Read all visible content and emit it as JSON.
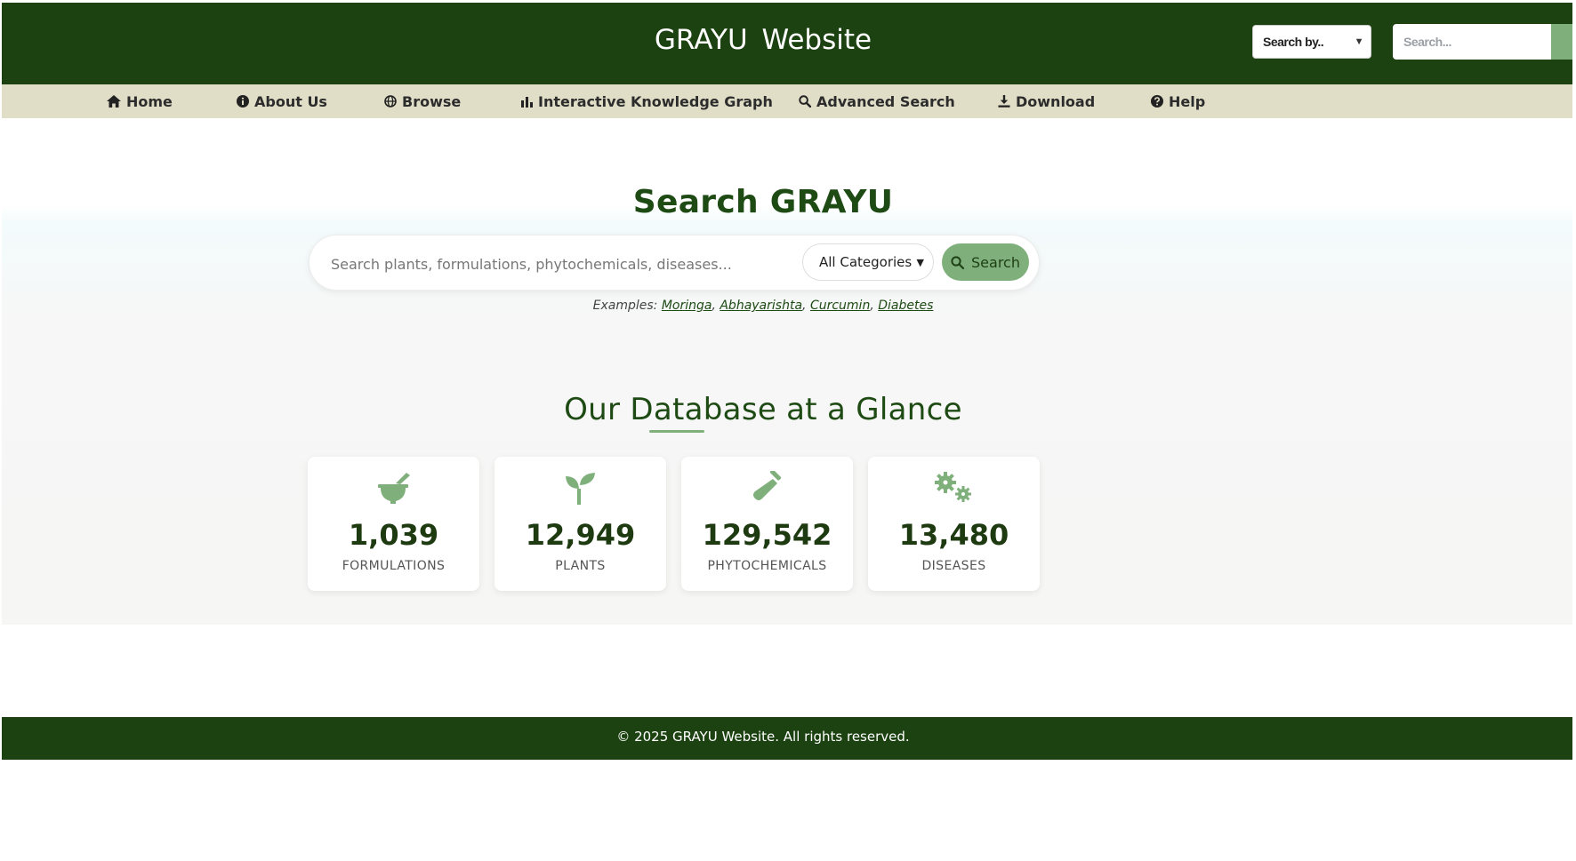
{
  "header": {
    "title": "GRAYU  Website",
    "search_by": "Search by..",
    "search_placeholder": "Search..."
  },
  "nav": {
    "items": [
      {
        "label": "Home",
        "icon": "home-icon"
      },
      {
        "label": "About Us",
        "icon": "info-icon"
      },
      {
        "label": "Browse",
        "icon": "globe-icon"
      },
      {
        "label": "Interactive Knowledge Graph",
        "icon": "chart-icon"
      },
      {
        "label": "Advanced Search",
        "icon": "search-icon"
      },
      {
        "label": "Download",
        "icon": "download-icon"
      },
      {
        "label": "Help",
        "icon": "help-icon"
      }
    ]
  },
  "hero": {
    "title": "Search GRAYU",
    "search_placeholder": "Search plants, formulations, phytochemicals, diseases...",
    "category": "All Categories",
    "search_button": "Search",
    "examples_label": "Examples:",
    "examples": [
      "Moringa",
      "Abhayarishta",
      "Curcumin",
      "Diabetes"
    ]
  },
  "glance": {
    "title": "Our Database at a Glance",
    "stats": [
      {
        "value": "1,039",
        "label": "FORMULATIONS",
        "icon": "mortar-pestle-icon"
      },
      {
        "value": "12,949",
        "label": "PLANTS",
        "icon": "seedling-icon"
      },
      {
        "value": "129,542",
        "label": "PHYTOCHEMICALS",
        "icon": "test-tube-icon"
      },
      {
        "value": "13,480",
        "label": "DISEASES",
        "icon": "virus-icon"
      }
    ]
  },
  "footer": {
    "text": "© 2025 GRAYU Website. All rights reserved."
  },
  "colors": {
    "header_bg": "#1c4211",
    "nav_bg": "#e0dec7",
    "accent": "#7fb07b",
    "title_green": "#1e4a14"
  }
}
